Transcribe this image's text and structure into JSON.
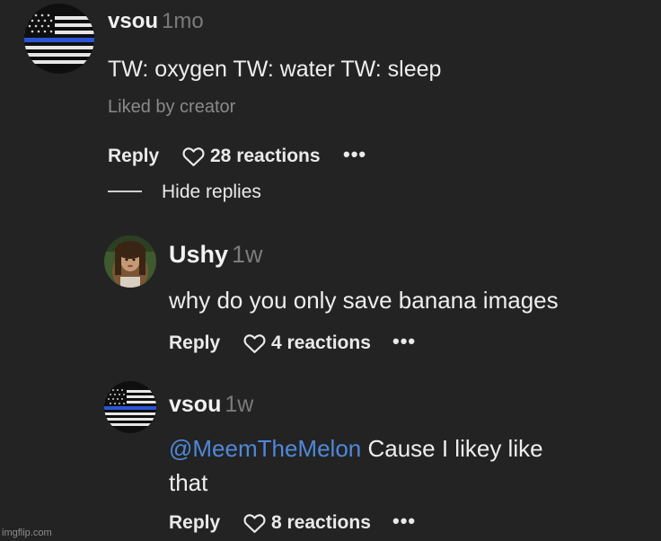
{
  "comments": [
    {
      "username": "vsou",
      "time": "1mo",
      "text": "TW: oxygen TW: water TW: sleep",
      "liked_label": "Liked by creator",
      "reply_label": "Reply",
      "reactions": "28 reactions",
      "more_icon": "•••"
    },
    {
      "username": "Ushy",
      "time": "1w",
      "text": "why do you only save banana images",
      "reply_label": "Reply",
      "reactions": "4 reactions",
      "more_icon": "•••"
    },
    {
      "username": "vsou",
      "time": "1w",
      "mention": "@MeemTheMelon",
      "text_line1": " Cause I likey like",
      "text_line2": "that",
      "reply_label": "Reply",
      "reactions": "8 reactions",
      "more_icon": "•••"
    }
  ],
  "thread": {
    "hide_replies_label": "Hide replies"
  },
  "watermark": "imgflip.com",
  "colors": {
    "background": "#232324",
    "mention": "#4f88d8",
    "muted": "#7b7b7b"
  }
}
